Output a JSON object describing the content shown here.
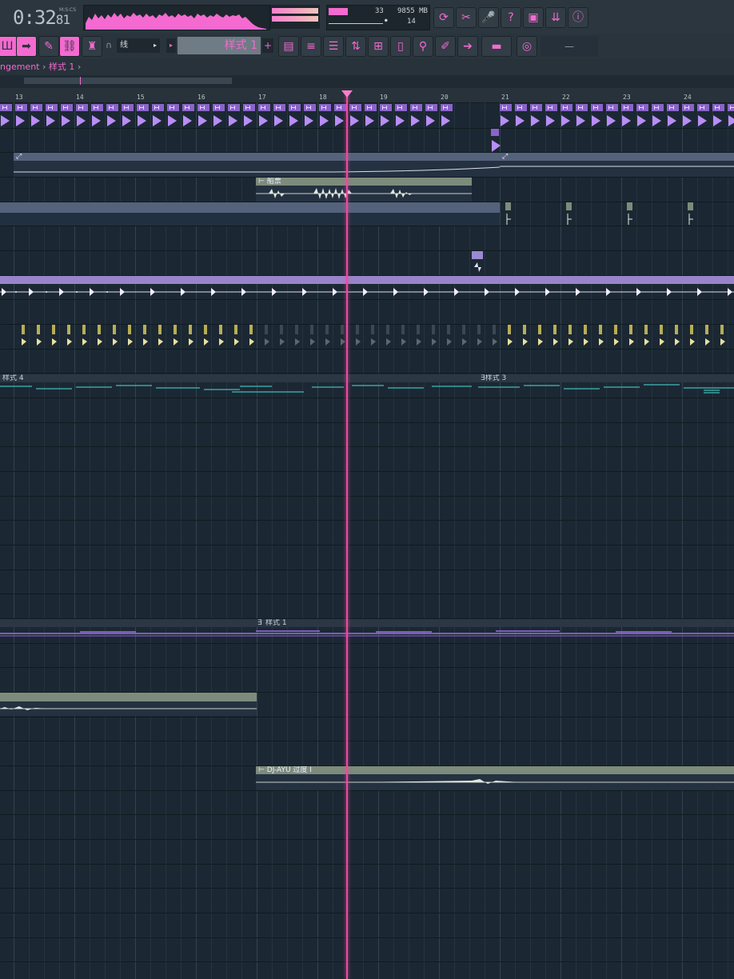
{
  "toolbar": {
    "time_main": "0:32",
    "time_frac": "81",
    "time_unit": "M:S:CS",
    "cpu_value": "33",
    "memory": "9855 MB",
    "polyphony": "14",
    "snap_label": "线",
    "pattern_label": "样式 1",
    "accent_color": "#f46ad0"
  },
  "breadcrumb": {
    "root": "ngement",
    "sep": "›",
    "pattern": "样式 1",
    "tail": "›"
  },
  "ruler": {
    "bars": [
      "13",
      "14",
      "15",
      "16",
      "17",
      "18",
      "19",
      "20",
      "21",
      "22",
      "23",
      "24"
    ]
  },
  "clips": {
    "sample_1": "船票",
    "pattern_4": "样式 4",
    "pattern_3": "样式 3",
    "pattern_1": "样式 1",
    "dj_clip": "DJ-AYU 过度 Ⅰ"
  },
  "icons": [
    "piano-roll-icon",
    "arrow-icon",
    "brush-icon",
    "link-icon",
    "stamp-icon",
    "magnet-icon",
    "pattern-prev-icon",
    "pattern-add-icon",
    "playlist-icon",
    "channel-rack-icon",
    "mixer-icon",
    "browser-icon",
    "plugin-picker-icon",
    "file-icon",
    "plug-icon",
    "pencil-icon",
    "slice-icon",
    "camera-icon",
    "tempo-icon",
    "refresh-icon",
    "cut-icon",
    "mic-icon",
    "help-icon",
    "save-icon",
    "render-icon",
    "info-icon"
  ]
}
